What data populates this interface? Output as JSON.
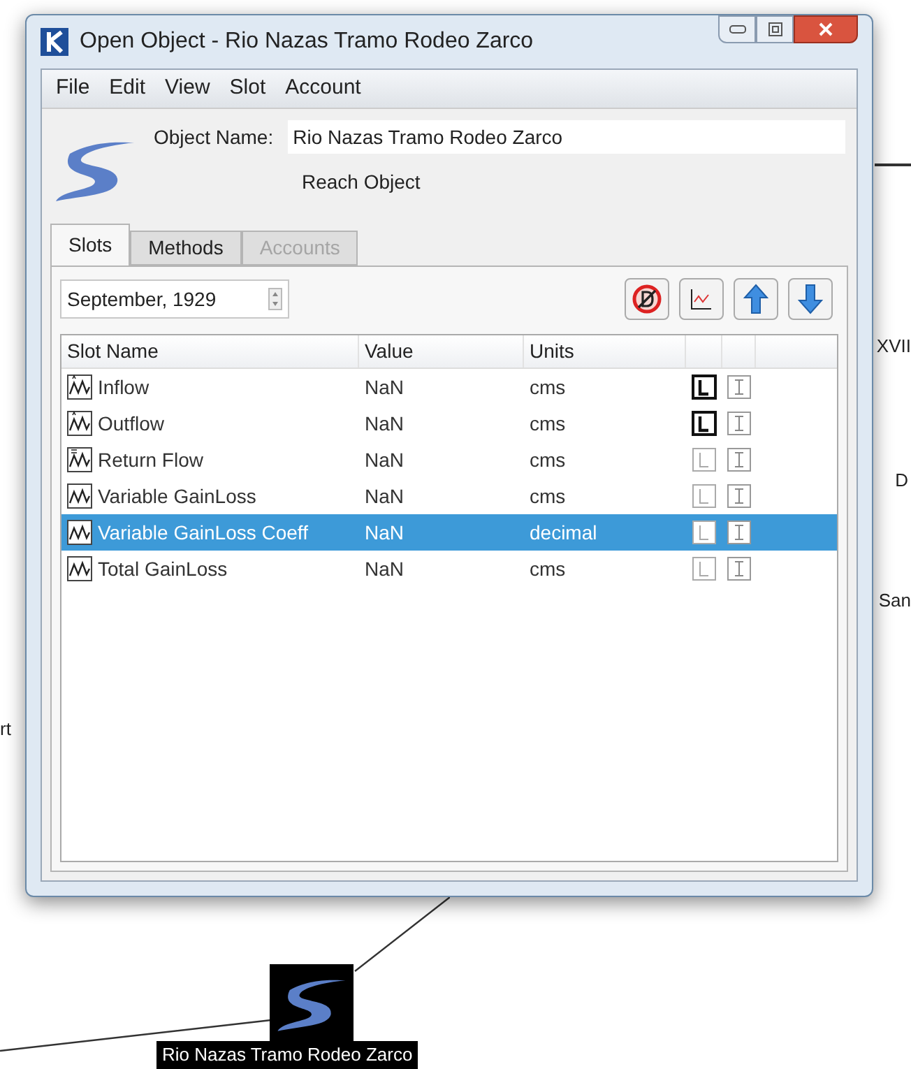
{
  "canvas": {
    "labels": [
      {
        "text": "XVII"
      },
      {
        "text": "D"
      },
      {
        "text": "San"
      },
      {
        "text": "rt"
      }
    ],
    "node": {
      "label": "Rio Nazas Tramo Rodeo Zarco"
    }
  },
  "window": {
    "title": "Open Object - Rio Nazas Tramo Rodeo Zarco"
  },
  "menu": [
    "File",
    "Edit",
    "View",
    "Slot",
    "Account"
  ],
  "object": {
    "name_label": "Object Name:",
    "name": "Rio Nazas Tramo Rodeo Zarco",
    "type": "Reach Object"
  },
  "tabs": [
    {
      "label": "Slots",
      "selected": true,
      "disabled": false
    },
    {
      "label": "Methods",
      "selected": false,
      "disabled": false
    },
    {
      "label": "Accounts",
      "selected": false,
      "disabled": true
    }
  ],
  "date": {
    "value": "September, 1929"
  },
  "table": {
    "columns": [
      "Slot Name",
      "Value",
      "Units"
    ],
    "rows": [
      {
        "kind": "inflow",
        "name": "Inflow",
        "value": "NaN",
        "units": "cms",
        "l_on": true,
        "selected": false
      },
      {
        "kind": "inflow",
        "name": "Outflow",
        "value": "NaN",
        "units": "cms",
        "l_on": true,
        "selected": false
      },
      {
        "kind": "multi",
        "name": "Return Flow",
        "value": "NaN",
        "units": "cms",
        "l_on": false,
        "selected": false
      },
      {
        "kind": "series",
        "name": "Variable GainLoss",
        "value": "NaN",
        "units": "cms",
        "l_on": false,
        "selected": false
      },
      {
        "kind": "series",
        "name": "Variable GainLoss Coeff",
        "value": "NaN",
        "units": "decimal",
        "l_on": false,
        "selected": true
      },
      {
        "kind": "series",
        "name": "Total GainLoss",
        "value": "NaN",
        "units": "cms",
        "l_on": false,
        "selected": false
      }
    ]
  }
}
